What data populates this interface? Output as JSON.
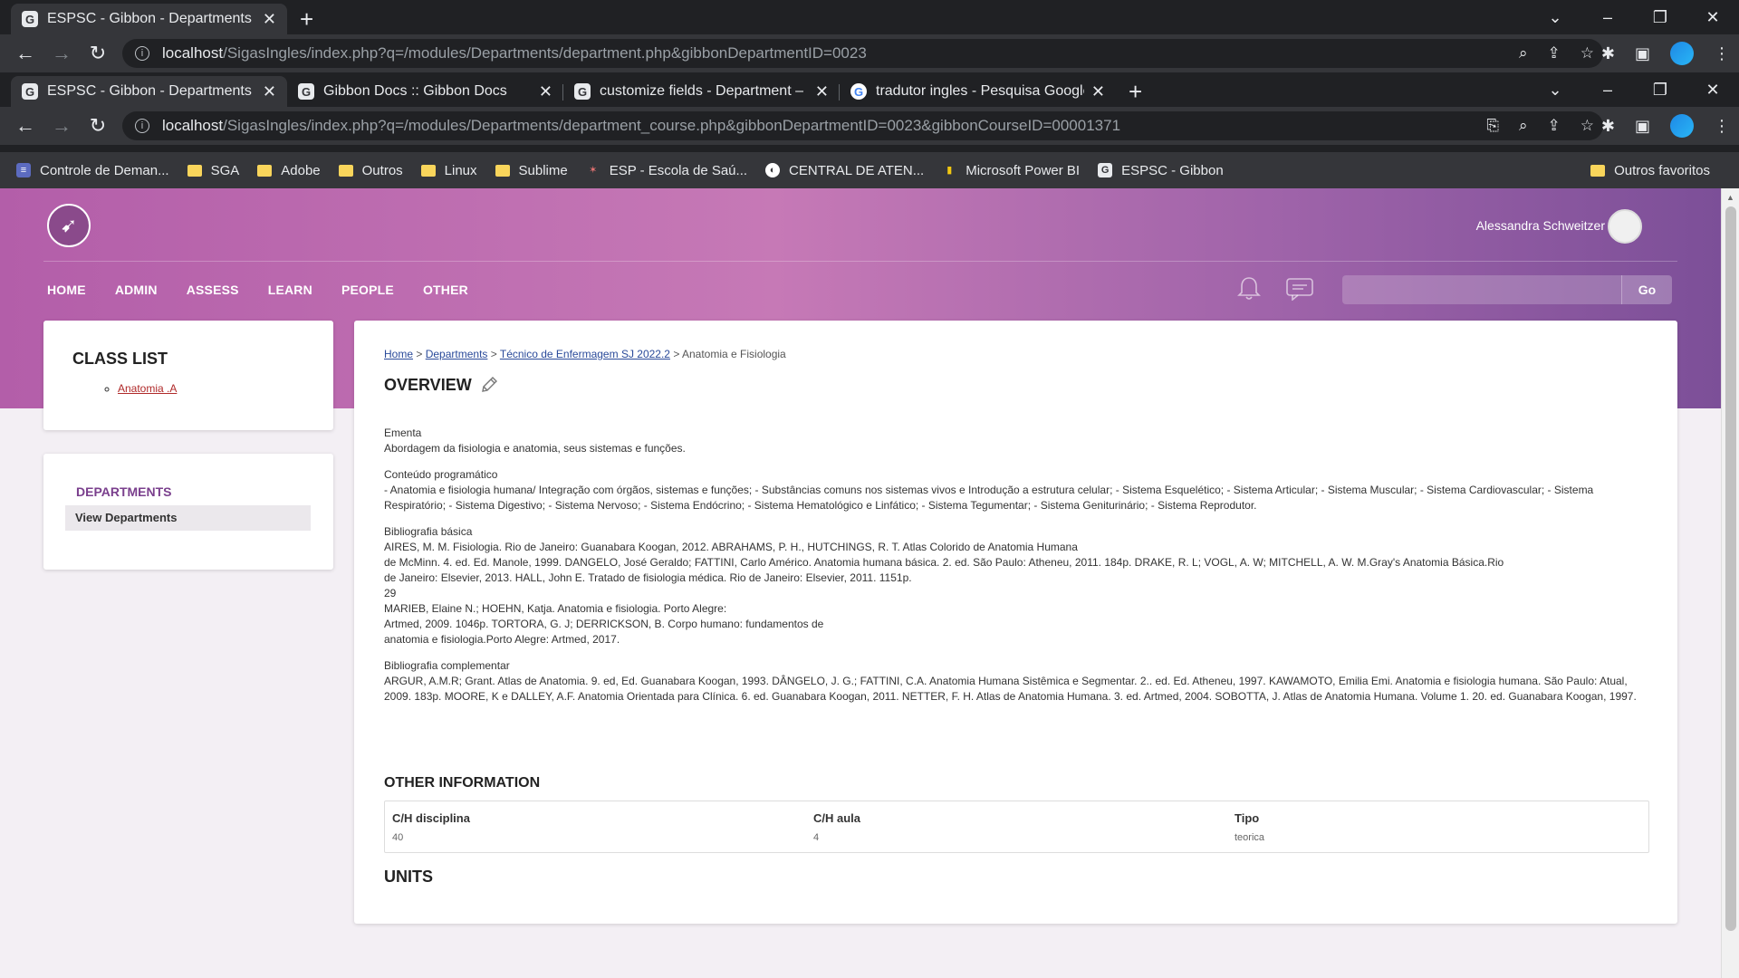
{
  "window1": {
    "tab_title": "ESPSC - Gibbon - Departments",
    "url_host": "localhost",
    "url_path": "/SigasIngles/index.php?q=/modules/Departments/department.php&gibbonDepartmentID=0023"
  },
  "window2": {
    "tabs": [
      {
        "title": "ESPSC - Gibbon - Departments",
        "icon": "G"
      },
      {
        "title": "Gibbon Docs :: Gibbon Docs",
        "icon": "G"
      },
      {
        "title": "customize fields - Department –",
        "icon": "G"
      },
      {
        "title": "tradutor ingles - Pesquisa Google",
        "icon": "google"
      }
    ],
    "url_host": "localhost",
    "url_path": "/SigasIngles/index.php?q=/modules/Departments/department_course.php&gibbonDepartmentID=0023&gibbonCourseID=00001371"
  },
  "bookmarks": [
    {
      "label": "Controle de Deman...",
      "icon": "list"
    },
    {
      "label": "SGA",
      "icon": "folder"
    },
    {
      "label": "Adobe",
      "icon": "folder"
    },
    {
      "label": "Outros",
      "icon": "folder"
    },
    {
      "label": "Linux",
      "icon": "folder"
    },
    {
      "label": "Sublime",
      "icon": "folder"
    },
    {
      "label": "ESP - Escola de Saú...",
      "icon": "esp"
    },
    {
      "label": "CENTRAL DE ATEN...",
      "icon": "globe"
    },
    {
      "label": "Microsoft Power BI",
      "icon": "powerbi"
    },
    {
      "label": "ESPSC - Gibbon",
      "icon": "G"
    }
  ],
  "bookmarks_other": "Outros favoritos",
  "header": {
    "username": "Alessandra Schweitzer",
    "nav": [
      "HOME",
      "ADMIN",
      "ASSESS",
      "LEARN",
      "PEOPLE",
      "OTHER"
    ],
    "search_button": "Go"
  },
  "sidebar": {
    "class_list_title": "CLASS LIST",
    "class_item": "Anatomia .A",
    "departments_title": "DEPARTMENTS",
    "departments_item": "View Departments"
  },
  "breadcrumb": {
    "home": "Home",
    "departments": "Departments",
    "course": "Técnico de Enfermagem SJ 2022.2",
    "current": "Anatomia e Fisiologia",
    "sep": " > "
  },
  "overview": {
    "title": "OVERVIEW",
    "ementa_label": "Ementa",
    "ementa_text": "Abordagem da fisiologia e anatomia, seus sistemas e funções.",
    "conteudo_label": "Conteúdo programático",
    "conteudo_text": "- Anatomia e fisiologia humana/ Integração com órgãos, sistemas e funções; - Substâncias comuns nos sistemas vivos e Introdução a estrutura celular; - Sistema Esquelético; - Sistema Articular; - Sistema Muscular; - Sistema Cardiovascular; - Sistema Respiratório; - Sistema Digestivo; - Sistema Nervoso; - Sistema Endócrino; - Sistema Hematológico e Linfático; - Sistema Tegumentar; - Sistema Geniturinário; - Sistema Reprodutor.",
    "bib_basica_label": "Bibliografia básica",
    "bib_basica_lines": [
      "AIRES, M. M. Fisiologia. Rio de Janeiro: Guanabara Koogan, 2012. ABRAHAMS, P. H., HUTCHINGS, R. T. Atlas Colorido de Anatomia Humana",
      "de McMinn. 4. ed. Ed. Manole, 1999. DANGELO, José Geraldo; FATTINI, Carlo Américo. Anatomia humana básica. 2. ed. São Paulo: Atheneu, 2011. 184p. DRAKE, R. L; VOGL, A. W; MITCHELL, A. W. M.Gray's Anatomia Básica.Rio",
      "de Janeiro: Elsevier, 2013. HALL, John E. Tratado de fisiologia médica. Rio de Janeiro: Elsevier, 2011. 1151p.",
      "29",
      "MARIEB, Elaine N.; HOEHN, Katja. Anatomia e fisiologia. Porto Alegre:",
      "Artmed, 2009. 1046p. TORTORA, G. J; DERRICKSON, B. Corpo humano: fundamentos de",
      "anatomia e fisiologia.Porto Alegre: Artmed, 2017."
    ],
    "bib_comp_label": "Bibliografia complementar",
    "bib_comp_text": "ARGUR, A.M.R; Grant. Atlas de Anatomia. 9. ed, Ed. Guanabara Koogan, 1993. DÂNGELO, J. G.; FATTINI, C.A. Anatomia Humana Sistêmica e Segmentar. 2.. ed. Ed. Atheneu, 1997. KAWAMOTO, Emilia Emi. Anatomia e fisiologia humana. São Paulo: Atual, 2009. 183p. MOORE, K e DALLEY, A.F. Anatomia Orientada para Clínica. 6. ed. Guanabara Koogan, 2011. NETTER, F. H. Atlas de Anatomia Humana. 3. ed. Artmed, 2004. SOBOTTA, J. Atlas de Anatomia Humana. Volume 1. 20. ed. Guanabara Koogan, 1997."
  },
  "other_info": {
    "title": "OTHER INFORMATION",
    "fields": [
      {
        "label": "C/H disciplina",
        "value": "40"
      },
      {
        "label": "C/H aula",
        "value": "4"
      },
      {
        "label": "Tipo",
        "value": "teorica"
      }
    ]
  },
  "units_title": "UNITS"
}
